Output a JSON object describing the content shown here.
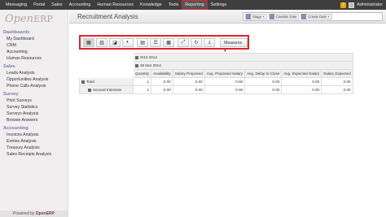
{
  "topmenu": [
    "Messaging",
    "Portal",
    "Sales",
    "Accounting",
    "Human Resources",
    "Knowledge",
    "Tools",
    "Reporting",
    "Settings"
  ],
  "active_menu": "Reporting",
  "user": {
    "name": "Administrator",
    "notification_count": "1"
  },
  "logo": {
    "part1": "Open",
    "part2": "ERP"
  },
  "sidebar": [
    {
      "section": "Dashboards",
      "items": [
        "My Dashboard",
        "CRM",
        "Accounting",
        "Human Resources"
      ]
    },
    {
      "section": "Sales",
      "items": [
        "Leads Analysis",
        "Opportunities Analysis",
        "Phone Calls Analysis"
      ]
    },
    {
      "section": "Survey",
      "items": [
        "Print Surveys",
        "Survey Statistics",
        "Surveys Analysis",
        "Browse Answers"
      ]
    },
    {
      "section": "Accounting",
      "items": [
        "Invoices Analysis",
        "Entries Analysis",
        "Treasury Analysis",
        "Sales Receipts Analysis"
      ]
    }
  ],
  "footer": {
    "prefix": "Powered by",
    "brand": "OpenERP"
  },
  "page_title": "Recruitment Analysis",
  "search_facets": [
    "Stage ×",
    "Creation Date",
    "Create Date ×"
  ],
  "toolbar": {
    "measures_label": "Measures ▾"
  },
  "pivot": {
    "col_group": "W13 2014",
    "col_sub": "28 Mar 2014",
    "measures": [
      "Quantity",
      "Availability",
      "Salary Proposed",
      "Avg. Proposed Salary",
      "Avg. Delay to Close",
      "Avg. Expected Salary",
      "Salary Expected"
    ],
    "rows": [
      {
        "label": "Total",
        "values": [
          "1",
          "0.00",
          "0.00",
          "0.00",
          "0.00",
          "0.00",
          "0.00"
        ]
      },
      {
        "label": "Second Interview",
        "values": [
          "1",
          "0.00",
          "0.00",
          "0.00",
          "0.00",
          "0.00",
          "0.00"
        ]
      }
    ]
  }
}
